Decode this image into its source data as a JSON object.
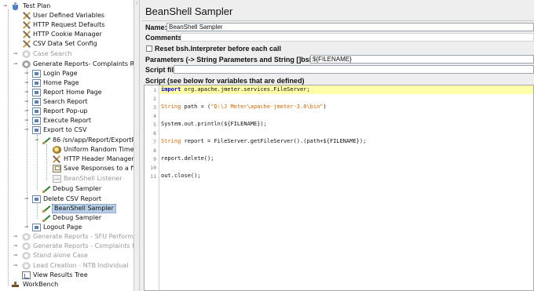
{
  "tree": {
    "items": [
      {
        "label": "Test Plan",
        "icon": "flask-icon",
        "state": "normal"
      },
      {
        "label": "User Defined Variables",
        "icon": "config-cross-icon",
        "state": "normal"
      },
      {
        "label": "HTTP Request Defaults",
        "icon": "config-cross-icon",
        "state": "normal"
      },
      {
        "label": "HTTP Cookie Manager",
        "icon": "config-cross-icon",
        "state": "normal"
      },
      {
        "label": "CSV Data Set Config",
        "icon": "config-cross-icon",
        "state": "normal"
      },
      {
        "label": "Case Search",
        "icon": "thread-group-gear-icon",
        "state": "disabled"
      },
      {
        "label": "Generate Reports- Complaints Res",
        "icon": "thread-group-gear-icon",
        "state": "normal"
      },
      {
        "label": "Login Page",
        "icon": "controller-icon",
        "state": "normal"
      },
      {
        "label": "Home Page",
        "icon": "controller-icon",
        "state": "normal"
      },
      {
        "label": "Report Home Page",
        "icon": "controller-icon",
        "state": "normal"
      },
      {
        "label": "Search Report",
        "icon": "controller-icon",
        "state": "normal"
      },
      {
        "label": "Report Pop-up",
        "icon": "controller-icon",
        "state": "normal"
      },
      {
        "label": "Execute Report",
        "icon": "controller-icon",
        "state": "normal"
      },
      {
        "label": "Export to CSV",
        "icon": "controller-icon",
        "state": "normal"
      },
      {
        "label": "86 /sn/app/Report/ExportRep",
        "icon": "sampler-pen-icon",
        "state": "normal"
      },
      {
        "label": "Uniform Random Timer",
        "icon": "timer-icon",
        "state": "normal"
      },
      {
        "label": "HTTP Header Manager",
        "icon": "config-cross-icon",
        "state": "normal"
      },
      {
        "label": "Save Responses to a file",
        "icon": "save-file-icon",
        "state": "normal"
      },
      {
        "label": "BeanShell Listener",
        "icon": "listener-icon",
        "state": "disabled"
      },
      {
        "label": "Debug Sampler",
        "icon": "sampler-pen-icon",
        "state": "normal"
      },
      {
        "label": "Delete CSV Report",
        "icon": "controller-icon",
        "state": "normal"
      },
      {
        "label": "BeanShell Sampler",
        "icon": "sampler-pen-icon",
        "state": "selected"
      },
      {
        "label": "Debug Sampler",
        "icon": "sampler-pen-icon",
        "state": "normal"
      },
      {
        "label": "Logout Page",
        "icon": "controller-icon",
        "state": "normal"
      },
      {
        "label": "Generate Reports - SFU Performan",
        "icon": "thread-group-gear-icon",
        "state": "disabled"
      },
      {
        "label": "Generate Reports - Complaints Res",
        "icon": "thread-group-gear-icon",
        "state": "disabled"
      },
      {
        "label": "Stand alone Case",
        "icon": "thread-group-gear-icon",
        "state": "disabled"
      },
      {
        "label": "Lead Creation - NTB Individual",
        "icon": "thread-group-gear-icon",
        "state": "disabled"
      },
      {
        "label": "View Results Tree",
        "icon": "results-tree-icon",
        "state": "normal"
      },
      {
        "label": "WorkBench",
        "icon": "workbench-icon",
        "state": "normal"
      }
    ]
  },
  "panel": {
    "title": "BeanShell Sampler",
    "name_label": "Name:",
    "name_value": "BeanShell Sampler",
    "comments_label": "Comments:",
    "reset_label": "Reset bsh.Interpreter before each call",
    "params_label": "Parameters (-> String Parameters and String []bsh.args)",
    "params_value": "${FILENAME}",
    "script_file_label": "Script file",
    "script_file_value": "",
    "script_label": "Script (see below for variables that are defined)"
  },
  "code": {
    "line_numbers": [
      "1",
      "2",
      "3",
      "4",
      "5",
      "6",
      "7",
      "8",
      "9",
      "10",
      "11"
    ],
    "l1_kw": "import",
    "l1_rest": " org.apache.jmeter.services.FileServer;",
    "l3_type": "String",
    "l3_mid": " path = (",
    "l3_str": "\"D:\\J Meter\\apache-jmeter-3.0\\bin\"",
    "l3_end": ")",
    "l5": "System.out.println(${FILENAME});",
    "l7_type": "String",
    "l7_rest": " report = FileServer.getFileServer().(path+${FILENAME});",
    "l9": "report.delete();",
    "l11": "out.close();"
  },
  "colors": {
    "selection": "#b9cfe7",
    "current_line": "#ffffaa",
    "keyword": "#0000cc",
    "string": "#cc6600",
    "panel_bg": "#eeeeee"
  }
}
